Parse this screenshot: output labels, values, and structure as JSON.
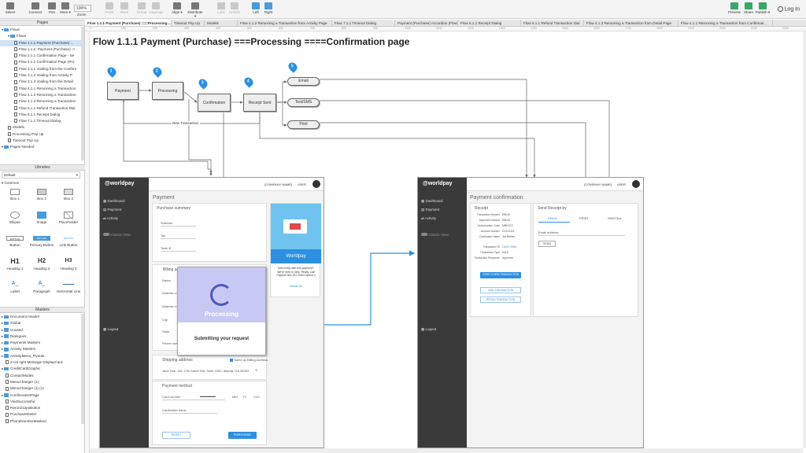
{
  "toolbar": {
    "items": [
      {
        "label": "Select"
      },
      {
        "label": "Connect"
      },
      {
        "label": "Pen"
      },
      {
        "label": "More ▾"
      },
      {
        "label": "Front"
      },
      {
        "label": "Back"
      },
      {
        "label": "Group"
      },
      {
        "label": "Ungroup"
      },
      {
        "label": "Align ▾"
      },
      {
        "label": "Distribute ▾"
      },
      {
        "label": "Lock"
      },
      {
        "label": "Unlock"
      },
      {
        "label": "Left"
      },
      {
        "label": "Right"
      }
    ],
    "zoom": "100%",
    "zoom_label": "Zoom",
    "right": [
      {
        "label": "Preview"
      },
      {
        "label": "Share"
      },
      {
        "label": "Publish ▾"
      }
    ],
    "login": "Log In"
  },
  "tabs": [
    "Flow 1.1.1 Payment (Purchase) ===Processing....",
    "Timeout Pop Up",
    "Models",
    "Flow 4.1.2 Rerunning a Transaction from Activity Page",
    "Flow 7.1.1 Timeout Dialog",
    "Payment (Purchase) Accordion (Flow1)",
    "Flow 6.1.1 Receipt Dialog",
    "Flow 5.1.1 Refund Transaction Dial",
    "Flow 4.1.3 Rerunning a Transaction from Detail Page",
    "Flow 4.1.1 Rerunning a Transaction from Confirmati..."
  ],
  "ruler": [
    "0",
    "100",
    "200",
    "300",
    "400",
    "500",
    "600",
    "700",
    "800",
    "900",
    "1000",
    "1100",
    "1200",
    "1300",
    "1400",
    "1500",
    "1600",
    "1700",
    "1800",
    "1900",
    "2000",
    "2100",
    "2200"
  ],
  "pages": {
    "title": "Pages",
    "items": [
      {
        "label": "Flows",
        "indent": 0,
        "type": "folder"
      },
      {
        "label": "Flows",
        "indent": 1,
        "type": "folder"
      },
      {
        "label": "Flow 1.1.1 Payment (Purchase) ...",
        "indent": 2,
        "type": "page",
        "selected": true
      },
      {
        "label": "Flow 1.1.2. Payment (Purchase) ->",
        "indent": 2,
        "type": "page"
      },
      {
        "label": "Flow 2.1.1 Confirmation Page - Se",
        "indent": 2,
        "type": "page"
      },
      {
        "label": "Flow 2.1.2 Confirmation Page (Pro",
        "indent": 2,
        "type": "page"
      },
      {
        "label": "Flow 3.1.1 Voiding from the Confirm",
        "indent": 2,
        "type": "page"
      },
      {
        "label": "Flow 3.1.2 Voiding from Activity P",
        "indent": 2,
        "type": "page"
      },
      {
        "label": "Flow 3.1.3 Voiding from the Detail",
        "indent": 2,
        "type": "page"
      },
      {
        "label": "Flow 4.1.1 Rerunning a Transaction",
        "indent": 2,
        "type": "page"
      },
      {
        "label": "Flow 4.1.2 Rerunning a Transaction",
        "indent": 2,
        "type": "page"
      },
      {
        "label": "Flow 4.1.3 Rerunning a Transaction",
        "indent": 2,
        "type": "page"
      },
      {
        "label": "Flow 5.1.1 Refund Transaction Dial",
        "indent": 2,
        "type": "page"
      },
      {
        "label": "Flow 6.1.1 Receipt Dialog",
        "indent": 2,
        "type": "page"
      },
      {
        "label": "Flow 7.1.1 Timeout Dialog",
        "indent": 2,
        "type": "page"
      },
      {
        "label": "Models",
        "indent": 1,
        "type": "page"
      },
      {
        "label": "Processing Pop Up",
        "indent": 1,
        "type": "page"
      },
      {
        "label": "Timeout Pop Up",
        "indent": 1,
        "type": "page"
      },
      {
        "label": "Pages Needed",
        "indent": 0,
        "type": "folder"
      }
    ]
  },
  "libraries": {
    "title": "Libraries",
    "select": "Default",
    "group": "Common",
    "items": [
      {
        "label": "Box 1"
      },
      {
        "label": "Box 2"
      },
      {
        "label": "Box 3"
      },
      {
        "label": "Ellipse"
      },
      {
        "label": "Image"
      },
      {
        "label": "Placeholder"
      },
      {
        "label": "Button"
      },
      {
        "label": "Primary Button"
      },
      {
        "label": "Link Button"
      },
      {
        "label": "Heading 1"
      },
      {
        "label": "Heading 2"
      },
      {
        "label": "Heading 3"
      },
      {
        "label": "Label"
      },
      {
        "label": "Paragraph"
      },
      {
        "label": "Horizontal Line"
      }
    ],
    "glyphs": {
      "button": "BUTTON",
      "primary": "BUTTON",
      "link": "BUTTON",
      "h1": "H1",
      "h2": "H2",
      "h3": "H3",
      "label": "A_",
      "paragraph": "A_"
    }
  },
  "masters": {
    "title": "Masters",
    "items": [
      {
        "label": "Document Header",
        "type": "folder"
      },
      {
        "label": "Global",
        "type": "folder"
      },
      {
        "label": "Unused",
        "type": "folder"
      },
      {
        "label": "Dialogues",
        "type": "folder"
      },
      {
        "label": "Payments Masters",
        "type": "folder"
      },
      {
        "label": "Activity Masters",
        "type": "folder"
      },
      {
        "label": "ActivityMenu_Flyouts",
        "type": "folder"
      },
      {
        "label": "2-col right Message DisplayCard",
        "type": "page"
      },
      {
        "label": "CreditCardGraphic",
        "type": "folder"
      },
      {
        "label": "ContactModes",
        "type": "page"
      },
      {
        "label": "MenuChanger (1)",
        "type": "page"
      },
      {
        "label": "MenuChanger (1) (1)",
        "type": "page"
      },
      {
        "label": "ConfirmationPage",
        "type": "folder"
      },
      {
        "label": "VoidSuccessful",
        "type": "page"
      },
      {
        "label": "Rerun212pxButton",
        "type": "page"
      },
      {
        "label": "PurchaseMaster",
        "type": "page"
      },
      {
        "label": "PhoneNumberMasked",
        "type": "page"
      }
    ]
  },
  "canvas": {
    "title": "Flow 1.1.1     Payment (Purchase) ===Processing ====Confirmation page",
    "flow_boxes": [
      "Payment",
      "Processing",
      "Confirmation",
      "Receipt Sent"
    ],
    "pills": [
      "Email",
      "Text/SMS",
      "Print"
    ],
    "pins": [
      "1",
      "2",
      "3",
      "4",
      "5"
    ],
    "new_transaction": "New Transaction"
  },
  "screen_left": {
    "brand": "@worldpay",
    "company": "[COMPANY NAME]",
    "user": "USER",
    "nav": [
      "Dashboard",
      "Payment",
      "Activity"
    ],
    "toggle": "Classic View",
    "logout": "Logout",
    "page_title": "Payment",
    "purchase_summary": "Purchase summary",
    "fields": [
      "Subtotal",
      "Tax",
      "Total: $"
    ],
    "billing": "Billing ad...",
    "addr": [
      "Name",
      "Address Line 1",
      "Address Line 2",
      "City",
      "State",
      "Phone number"
    ],
    "shipping": "Shipping address",
    "same_billing": "Same as Billing Address",
    "ship_addr": "Jane Doe, 201 17th Street NW, Suite 1000, Atlanta, GA 30363",
    "payment_method": "Payment method",
    "card_number": "Card number",
    "mm": "MM",
    "yy": "YY",
    "cvc": "CVC",
    "cardholder": "Cardholder name",
    "reset": "RESET",
    "purchase": "PURCHASE",
    "promo_title": "Worldpay",
    "promo_text": "Need help with this payment? We're here to help. Really. Call Support 000-257-0000 Option 2",
    "promo_link": "Email us",
    "processing": "Processing",
    "submitting": "Submitting your request"
  },
  "screen_right": {
    "brand": "@worldpay",
    "company": "[COMPANY NAME]",
    "user": "USER",
    "nav": [
      "Dashboard",
      "Payment",
      "Activity"
    ],
    "toggle": "Classic View",
    "logout": "Logout",
    "page_title": "Payment confirmation",
    "receipt": "Receipt",
    "receipt_rows": [
      [
        "Transaction Amount",
        "$96.00"
      ],
      [
        "Approved Amount",
        "$96.00"
      ],
      [
        "Authorization Code",
        "MBHYGT"
      ],
      [
        "Account Number",
        "XXXX1111"
      ],
      [
        "Cardholder Name",
        "Joe Brillcie"
      ],
      [
        "Transaction ID",
        "1169274948"
      ],
      [
        "Transaction Type",
        "SALE"
      ],
      [
        "Transaction Response",
        "Approved"
      ]
    ],
    "start_new": "START A NEW TRANSACTION",
    "void": "VOID TRANSACTION",
    "rerun": "RERUN TRANSACTION",
    "send_receipt": "Send Receipt by",
    "send_tabs": [
      "EMAIL",
      "PRINT",
      "SMS/Text"
    ],
    "email_address": "Email address",
    "send": "SEND"
  },
  "colors": {
    "accent": "#2c8fe0",
    "sidebar": "#3a3a3a",
    "processing_bg": "#c8c8f4"
  }
}
